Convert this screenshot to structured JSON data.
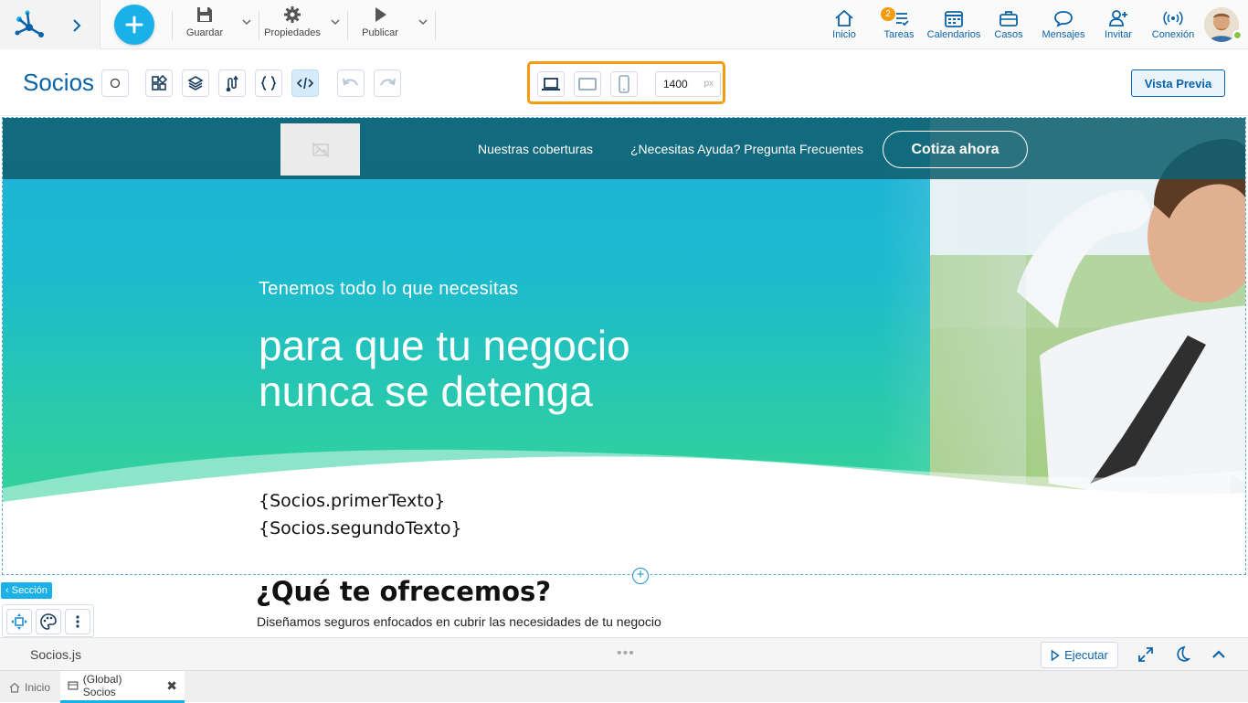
{
  "appbar": {
    "toolbar": {
      "save_label": "Guardar",
      "properties_label": "Propiedades",
      "publish_label": "Publicar"
    },
    "nav": [
      {
        "label": "Inicio",
        "icon": "home-icon"
      },
      {
        "label": "Tareas",
        "icon": "tasks-icon",
        "badge": "2"
      },
      {
        "label": "Calendarios",
        "icon": "calendar-icon"
      },
      {
        "label": "Casos",
        "icon": "briefcase-icon"
      },
      {
        "label": "Mensajes",
        "icon": "chat-icon"
      },
      {
        "label": "Invitar",
        "icon": "add-user-icon"
      },
      {
        "label": "Conexión",
        "icon": "connection-icon"
      }
    ],
    "accent": "#1ab0e8",
    "brand": "#0a63a8"
  },
  "editor": {
    "title": "Socios",
    "width_value": "1400",
    "width_unit": "px",
    "preview_label": "Vista Previa",
    "highlight": "#f39c12"
  },
  "hero": {
    "nav_links": [
      "Nuestras coberturas",
      "¿Necesitas Ayuda? Pregunta Frecuentes"
    ],
    "cta_label": "Cotiza ahora",
    "subtitle": "Tenemos todo lo que necesitas",
    "title_line1": "para que tu negocio",
    "title_line2": "nunca se detenga",
    "bind1": "{Socios.primerTexto}",
    "bind2": "{Socios.segundoTexto}"
  },
  "section": {
    "label": "Sección",
    "offer_title": "¿Qué te ofrecemos?",
    "offer_sub": "Diseñamos seguros enfocados en cubrir las necesidades de tu negocio"
  },
  "codebar": {
    "file": "Socios.js",
    "run_label": "Ejecutar"
  },
  "tabs": [
    {
      "label": "Inicio",
      "icon": "home-icon"
    },
    {
      "label": "(Global) Socios",
      "icon": "page-icon",
      "active": true
    }
  ]
}
